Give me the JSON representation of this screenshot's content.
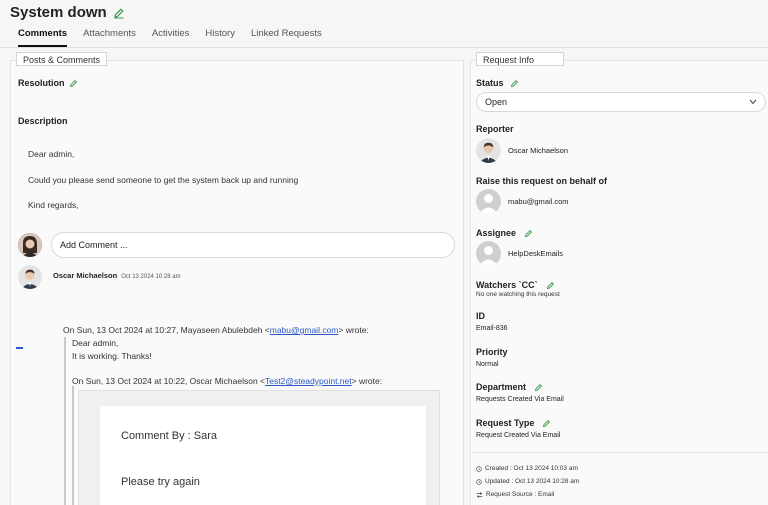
{
  "header": {
    "title": "System down"
  },
  "tabs": [
    {
      "label": "Comments",
      "active": true
    },
    {
      "label": "Attachments"
    },
    {
      "label": "Activities"
    },
    {
      "label": "History"
    },
    {
      "label": "Linked Requests"
    }
  ],
  "posts": {
    "legend": "Posts & Comments",
    "resolution_label": "Resolution",
    "description_label": "Description",
    "description_lines": [
      "Dear admin,",
      "Could you please send someone to get the system back up and running",
      "Kind regards,"
    ],
    "add_comment_placeholder": "Add Comment ...",
    "comment": {
      "author": "Oscar Michaelson",
      "timestamp": "Oct 13 2024 10:28 am",
      "reply_header_prefix": "On Sun, 13 Oct 2024 at 10:27, Mayaseen Abulebdeh <",
      "reply_header_email": "mabu@gmail.com",
      "reply_header_suffix": "> wrote:",
      "reply_lines": [
        "Dear admin,",
        "It is working. Thanks!"
      ],
      "nested_header_prefix": "On Sun, 13 Oct 2024 at 10:22, Oscar Michaelson <",
      "nested_header_email": "Test2@steadypoint.net",
      "nested_header_suffix": "> wrote:",
      "nested_comment_by": "Comment By : Sara",
      "nested_body": "Please try again"
    }
  },
  "request_info": {
    "legend": "Request Info",
    "status_label": "Status",
    "status_value": "Open",
    "reporter_label": "Reporter",
    "reporter_name": "Oscar Michaelson",
    "behalf_label": "Raise this request on behalf of",
    "behalf_value": "mabu@gmail.com",
    "assignee_label": "Assignee",
    "assignee_value": "HelpDeskEmails",
    "watchers_label": "Watchers `CC`",
    "watchers_value": "No one watching this request",
    "id_label": "ID",
    "id_value": "Email-836",
    "priority_label": "Priority",
    "priority_value": "Normal",
    "department_label": "Department",
    "department_value": "Requests Created Via Email",
    "request_type_label": "Request Type",
    "request_type_value": "Request Created Via Email",
    "created": "Created : Oct 13 2024 10:03 am",
    "updated": "Updated : Oct 13 2024 10:28 am",
    "source": "Request Source : Email"
  },
  "colors": {
    "accent_green": "#3c9a4e",
    "link_blue": "#2a56c6"
  }
}
